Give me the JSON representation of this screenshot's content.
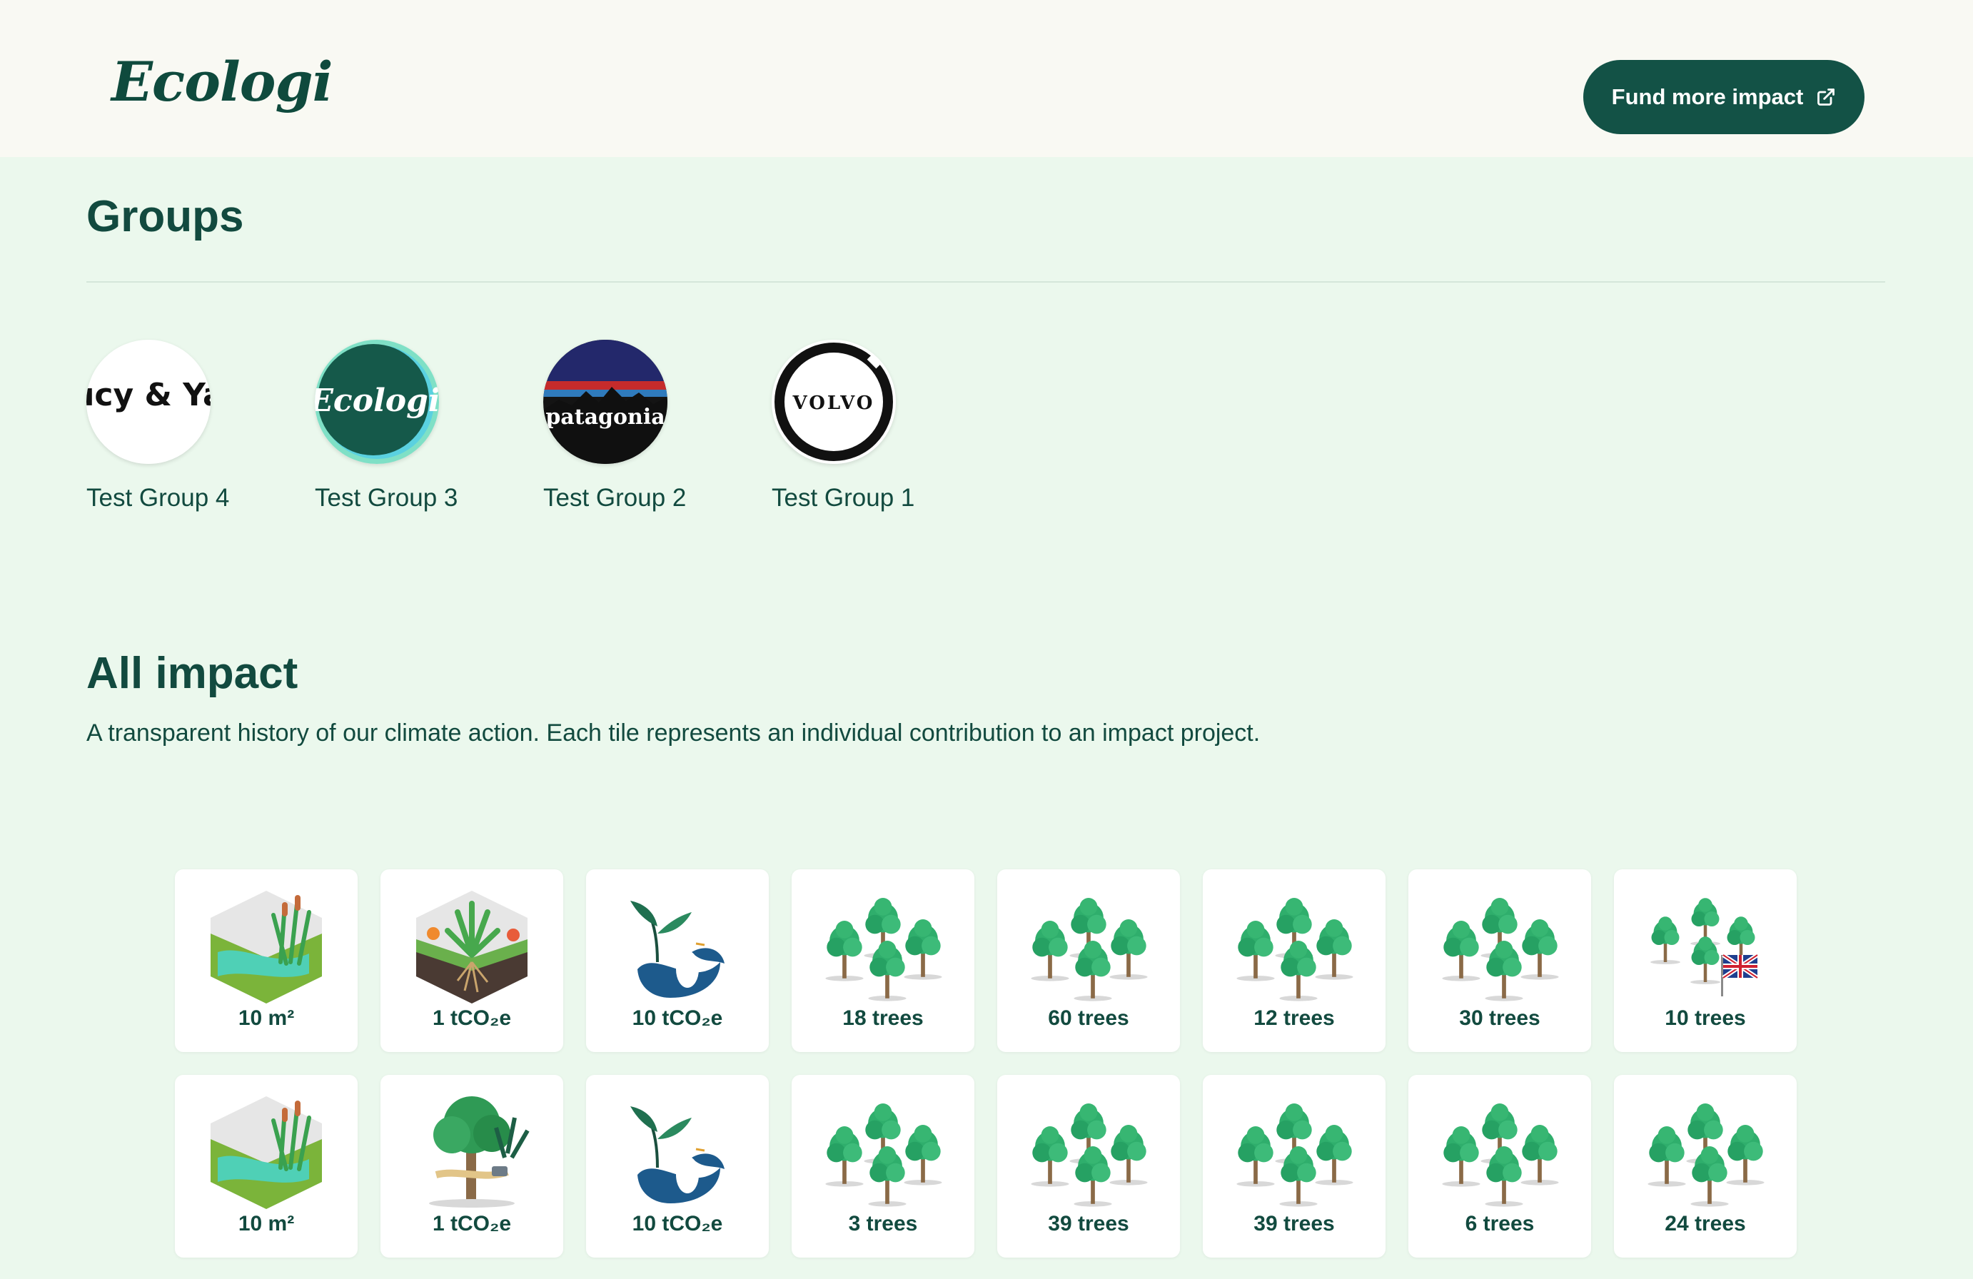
{
  "header": {
    "logo_text": "Ecologi",
    "fund_button_label": "Fund more impact"
  },
  "groups": {
    "title": "Groups",
    "items": [
      {
        "label": "Test Group 4",
        "logo": "lucy-yak-logo-icon"
      },
      {
        "label": "Test Group 3",
        "logo": "ecologi-logo-icon"
      },
      {
        "label": "Test Group 2",
        "logo": "patagonia-logo-icon"
      },
      {
        "label": "Test Group 1",
        "logo": "volvo-logo-icon"
      }
    ],
    "logo_texts": {
      "lucy_yak": "Lucy & Yak",
      "ecologi": "Ecologi",
      "patagonia": "patagonia",
      "volvo": "VOLVO"
    }
  },
  "impact": {
    "title": "All impact",
    "description": "A transparent history of our climate action. Each tile represents an individual contribution to an impact project.",
    "tiles": [
      {
        "label": "10 m²",
        "art": "wetland-icon"
      },
      {
        "label": "1 tCO₂e",
        "art": "soil-carbon-icon"
      },
      {
        "label": "10 tCO₂e",
        "art": "heron-coastal-icon"
      },
      {
        "label": "18 trees",
        "art": "trees-icon"
      },
      {
        "label": "60 trees",
        "art": "trees-icon"
      },
      {
        "label": "12 trees",
        "art": "trees-icon"
      },
      {
        "label": "30 trees",
        "art": "trees-icon"
      },
      {
        "label": "10 trees",
        "art": "trees-uk-flag-icon"
      },
      {
        "label": "10 m²",
        "art": "wetland-icon"
      },
      {
        "label": "1 tCO₂e",
        "art": "forest-protection-icon"
      },
      {
        "label": "10 tCO₂e",
        "art": "heron-coastal-icon"
      },
      {
        "label": "3 trees",
        "art": "trees-icon"
      },
      {
        "label": "39 trees",
        "art": "trees-icon"
      },
      {
        "label": "39 trees",
        "art": "trees-icon"
      },
      {
        "label": "6 trees",
        "art": "trees-icon"
      },
      {
        "label": "24 trees",
        "art": "trees-icon"
      }
    ]
  },
  "colors": {
    "brand_dark": "#135246",
    "page_bg": "#ebf8ed",
    "header_bg": "#f9f9f3",
    "text": "#124a3f",
    "tree_green": "#2fae6c",
    "water": "#41c9b0"
  }
}
